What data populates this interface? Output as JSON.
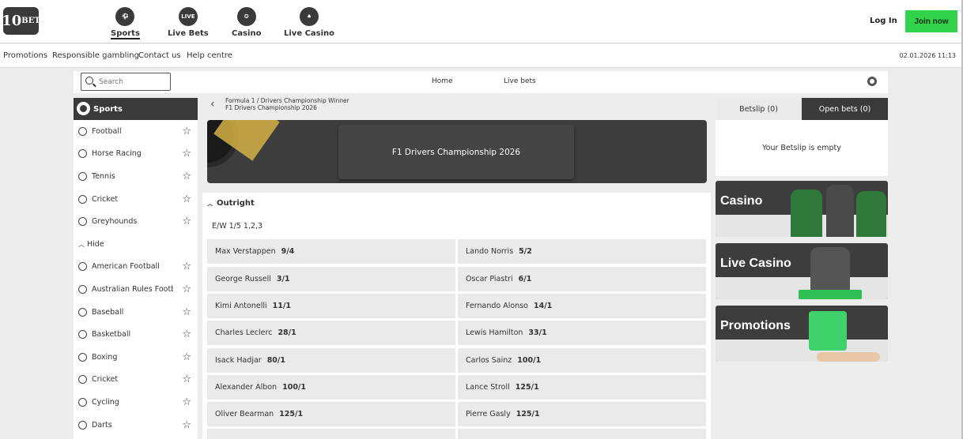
{
  "brand": {
    "logo_text": "10",
    "logo_sup": "BET"
  },
  "nav": {
    "items": [
      {
        "label": "Sports",
        "icon": "football-icon",
        "badge": ""
      },
      {
        "label": "Live Bets",
        "icon": "live-icon",
        "badge": "LIVE"
      },
      {
        "label": "Casino",
        "icon": "casino-chip-icon",
        "badge": ""
      },
      {
        "label": "Live Casino",
        "icon": "dealer-icon",
        "badge": ""
      }
    ],
    "login": "Log In",
    "join": "Join now",
    "accent": "#32d24a"
  },
  "subnav": {
    "links": [
      "Promotions",
      "Responsible gambling",
      "Contact us",
      "Help centre"
    ],
    "datetime": "02.01.2026 11:13"
  },
  "pagebar": {
    "search_placeholder": "Search",
    "tabs": [
      "Home",
      "Live bets"
    ]
  },
  "sidebar": {
    "header": "Sports",
    "top_items": [
      "Football",
      "Horse Racing",
      "Tennis",
      "Cricket",
      "Greyhounds"
    ],
    "hide_label": "Hide",
    "more_items": [
      "American Football",
      "Australian Rules Football",
      "Baseball",
      "Basketball",
      "Boxing",
      "Cricket",
      "Cycling",
      "Darts"
    ]
  },
  "breadcrumb": {
    "line1": "Formula 1 / Drivers Championship Winner",
    "line2": "F1 Drivers Championship 2026"
  },
  "banner": {
    "title": "F1 Drivers Championship 2026"
  },
  "market": {
    "title": "Outright",
    "each_way": "E/W 1/5 1,2,3",
    "selections": [
      {
        "name": "Max Verstappen",
        "odds": "9/4"
      },
      {
        "name": "Lando Norris",
        "odds": "5/2"
      },
      {
        "name": "George Russell",
        "odds": "3/1"
      },
      {
        "name": "Oscar Piastri",
        "odds": "6/1"
      },
      {
        "name": "Kimi Antonelli",
        "odds": "11/1"
      },
      {
        "name": "Fernando Alonso",
        "odds": "14/1"
      },
      {
        "name": "Charles Leclerc",
        "odds": "28/1"
      },
      {
        "name": "Lewis Hamilton",
        "odds": "33/1"
      },
      {
        "name": "Isack Hadjar",
        "odds": "80/1"
      },
      {
        "name": "Carlos Sainz",
        "odds": "100/1"
      },
      {
        "name": "Alexander Albon",
        "odds": "100/1"
      },
      {
        "name": "Lance Stroll",
        "odds": "125/1"
      },
      {
        "name": "Oliver Bearman",
        "odds": "125/1"
      },
      {
        "name": "Pierre Gasly",
        "odds": "125/1"
      }
    ]
  },
  "betslip": {
    "tab_betslip": "Betslip (0)",
    "tab_open": "Open bets (0)",
    "empty": "Your Betslip is empty"
  },
  "promos": [
    "Casino",
    "Live Casino",
    "Promotions"
  ]
}
